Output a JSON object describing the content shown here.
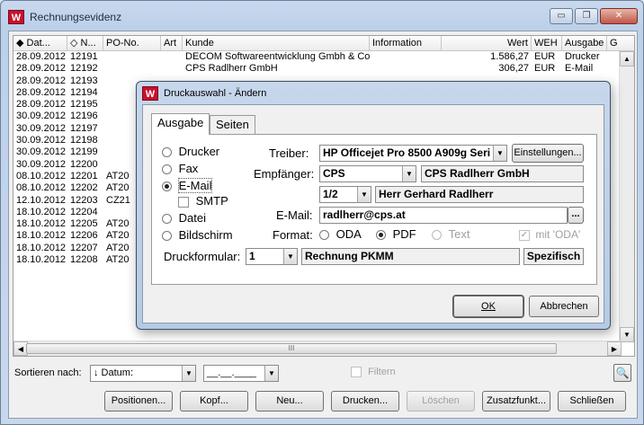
{
  "window": {
    "title": "Rechnungsevidenz",
    "icon_text": "W",
    "min_glyph": "▭",
    "max_glyph": "❐",
    "close_glyph": "✕"
  },
  "table": {
    "columns": [
      {
        "key": "datum",
        "label": "◆ Dat..."
      },
      {
        "key": "nr",
        "label": "◇ N..."
      },
      {
        "key": "po",
        "label": "PO-No."
      },
      {
        "key": "art",
        "label": "Art"
      },
      {
        "key": "kunde",
        "label": "Kunde"
      },
      {
        "key": "info",
        "label": "Information"
      },
      {
        "key": "wert",
        "label": "Wert"
      },
      {
        "key": "weh",
        "label": "WEH"
      },
      {
        "key": "ausgabe",
        "label": "Ausgabe"
      },
      {
        "key": "g",
        "label": "G"
      }
    ],
    "rows": [
      {
        "datum": "28.09.2012",
        "nr": "12191",
        "po": "",
        "art": "",
        "kunde": "DECOM Softwareentwicklung Gmbh & Co",
        "info": "",
        "wert": "1.586,27",
        "weh": "EUR",
        "ausgabe": "Drucker"
      },
      {
        "datum": "28.09.2012",
        "nr": "12192",
        "po": "",
        "art": "",
        "kunde": "CPS Radlherr GmbH",
        "info": "",
        "wert": "306,27",
        "weh": "EUR",
        "ausgabe": "E-Mail"
      },
      {
        "datum": "28.09.2012",
        "nr": "12193",
        "po": "",
        "art": "",
        "kunde": "",
        "info": "",
        "wert": "",
        "weh": "",
        "ausgabe": ""
      },
      {
        "datum": "28.09.2012",
        "nr": "12194",
        "po": "",
        "art": "",
        "kunde": "",
        "info": "",
        "wert": "",
        "weh": "",
        "ausgabe": ""
      },
      {
        "datum": "28.09.2012",
        "nr": "12195",
        "po": "",
        "art": "",
        "kunde": "",
        "info": "",
        "wert": "",
        "weh": "",
        "ausgabe": ""
      },
      {
        "datum": "30.09.2012",
        "nr": "12196",
        "po": "",
        "art": "",
        "kunde": "",
        "info": "",
        "wert": "",
        "weh": "",
        "ausgabe": ""
      },
      {
        "datum": "30.09.2012",
        "nr": "12197",
        "po": "",
        "art": "",
        "kunde": "",
        "info": "",
        "wert": "",
        "weh": "",
        "ausgabe": ""
      },
      {
        "datum": "30.09.2012",
        "nr": "12198",
        "po": "",
        "art": "",
        "kunde": "",
        "info": "",
        "wert": "",
        "weh": "",
        "ausgabe": ""
      },
      {
        "datum": "30.09.2012",
        "nr": "12199",
        "po": "",
        "art": "",
        "kunde": "",
        "info": "",
        "wert": "",
        "weh": "",
        "ausgabe": ""
      },
      {
        "datum": "30.09.2012",
        "nr": "12200",
        "po": "",
        "art": "",
        "kunde": "",
        "info": "",
        "wert": "",
        "weh": "",
        "ausgabe": ""
      },
      {
        "datum": "08.10.2012",
        "nr": "12201",
        "po": "AT20",
        "art": "",
        "kunde": "",
        "info": "",
        "wert": "",
        "weh": "",
        "ausgabe": ""
      },
      {
        "datum": "08.10.2012",
        "nr": "12202",
        "po": "AT20",
        "art": "",
        "kunde": "",
        "info": "",
        "wert": "",
        "weh": "",
        "ausgabe": ""
      },
      {
        "datum": "12.10.2012",
        "nr": "12203",
        "po": "CZ21",
        "art": "",
        "kunde": "",
        "info": "",
        "wert": "",
        "weh": "",
        "ausgabe": ""
      },
      {
        "datum": "18.10.2012",
        "nr": "12204",
        "po": "",
        "art": "",
        "kunde": "",
        "info": "",
        "wert": "",
        "weh": "",
        "ausgabe": ""
      },
      {
        "datum": "18.10.2012",
        "nr": "12205",
        "po": "AT20",
        "art": "",
        "kunde": "",
        "info": "",
        "wert": "",
        "weh": "",
        "ausgabe": ""
      },
      {
        "datum": "18.10.2012",
        "nr": "12206",
        "po": "AT20",
        "art": "",
        "kunde": "",
        "info": "",
        "wert": "",
        "weh": "",
        "ausgabe": ""
      },
      {
        "datum": "18.10.2012",
        "nr": "12207",
        "po": "AT20",
        "art": "",
        "kunde": "",
        "info": "",
        "wert": "",
        "weh": "",
        "ausgabe": ""
      },
      {
        "datum": "18.10.2012",
        "nr": "12208",
        "po": "AT20",
        "art": "",
        "kunde": "",
        "info": "",
        "wert": "",
        "weh": "",
        "ausgabe": ""
      }
    ],
    "scroll_up": "▲",
    "scroll_down": "▼",
    "scroll_left": "◀",
    "scroll_right": "▶",
    "hthumb_grip": "III"
  },
  "bottom": {
    "sort_label": "Sortieren nach:",
    "sort_value": "↓ Datum:",
    "date_value": "__.__.____",
    "dropdown_arrow": "▼",
    "filter_label": "Filtern",
    "search_glyph": "🔍",
    "buttons": {
      "positionen": "Positionen...",
      "kopf": "Kopf...",
      "neu": "Neu...",
      "drucken": "Drucken...",
      "loeschen": "Löschen",
      "zusatzfunkt": "Zusatzfunkt...",
      "schliessen": "Schließen"
    }
  },
  "dialog": {
    "title": "Druckauswahl - Ändern",
    "icon_text": "W",
    "tabs": {
      "ausgabe": "Ausgabe",
      "seiten": "Seiten"
    },
    "output_options": {
      "drucker": "Drucker",
      "fax": "Fax",
      "email": "E-Mail",
      "smtp": "SMTP",
      "datei": "Datei",
      "bildschirm": "Bildschirm"
    },
    "selected_output": "E-Mail",
    "treiber_label": "Treiber:",
    "treiber_value": "HP Officejet Pro 8500 A909g Seri",
    "einstellungen_button": "Einstellungen...",
    "empfaenger_label": "Empfänger:",
    "empfaenger_code": "CPS",
    "empfaenger_name": "CPS Radlherr GmbH",
    "kontakt_code": "1/2",
    "kontakt_name": "Herr Gerhard Radlherr",
    "email_label": "E-Mail:",
    "email_value": "radlherr@cps.at",
    "email_browse": "...",
    "format_label": "Format:",
    "formats": {
      "oda": "ODA",
      "pdf": "PDF",
      "text": "Text"
    },
    "selected_format": "PDF",
    "mit_oda_label": "mit 'ODA'",
    "druckformular_label": "Druckformular:",
    "druckformular_value": "1",
    "druckformular_name": "Rechnung PKMM",
    "spezifisch_button": "Spezifisch",
    "ok_button": "OK",
    "abbrechen_button": "Abbrechen",
    "check_glyph": "✓"
  }
}
